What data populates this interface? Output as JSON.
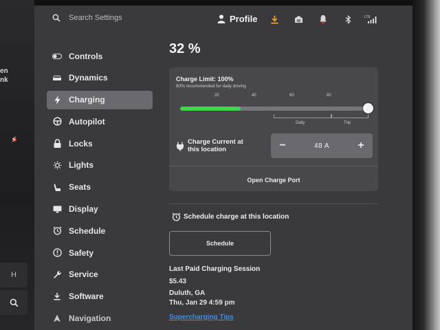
{
  "search": {
    "placeholder": "Search Settings"
  },
  "header": {
    "profile_label": "Profile",
    "icons": [
      "download-icon",
      "garage-icon",
      "bell-icon",
      "bluetooth-icon",
      "lte-signal-icon"
    ],
    "lte_label": "LTE"
  },
  "left_peek": {
    "line1": "en",
    "line2": "nk"
  },
  "sidebar": {
    "items": [
      {
        "label": "Controls",
        "icon": "toggle-icon"
      },
      {
        "label": "Dynamics",
        "icon": "car-icon"
      },
      {
        "label": "Charging",
        "icon": "bolt-icon",
        "active": true
      },
      {
        "label": "Autopilot",
        "icon": "steering-wheel-icon"
      },
      {
        "label": "Locks",
        "icon": "lock-icon"
      },
      {
        "label": "Lights",
        "icon": "sun-icon"
      },
      {
        "label": "Seats",
        "icon": "seat-icon"
      },
      {
        "label": "Display",
        "icon": "display-icon"
      },
      {
        "label": "Schedule",
        "icon": "alarm-clock-icon"
      },
      {
        "label": "Safety",
        "icon": "info-icon"
      },
      {
        "label": "Service",
        "icon": "wrench-icon"
      },
      {
        "label": "Software",
        "icon": "download-icon"
      },
      {
        "label": "Navigation",
        "icon": "navigation-arrow-icon"
      }
    ]
  },
  "charging": {
    "battery_percent": "32 %",
    "charge_limit_title": "Charge Limit: 100%",
    "charge_limit_subtitle": "80% recommended for daily driving",
    "slider_ticks": [
      "20",
      "40",
      "60",
      "80"
    ],
    "current_level_fraction": 0.32,
    "limit_fraction": 1.0,
    "zones": {
      "daily": "Daily",
      "trip": "Trip"
    },
    "charge_current_label": "Charge Current at this location",
    "charge_current_value": "48 A",
    "minus_label": "−",
    "plus_label": "+",
    "open_port_label": "Open Charge Port",
    "schedule_here_label": "Schedule charge at this location",
    "schedule_button_label": "Schedule",
    "last_session": {
      "title": "Last Paid Charging Session",
      "amount": "$5.43",
      "location": "Duluth, GA",
      "time": "Thu, Jan 29 4:59 pm"
    },
    "tips_link": "Supercharging Tips"
  },
  "colors": {
    "accent_green": "#3fd64a",
    "link_blue": "#3d8ef0",
    "download_orange": "#f0a020",
    "alert_red": "#e0303a"
  }
}
